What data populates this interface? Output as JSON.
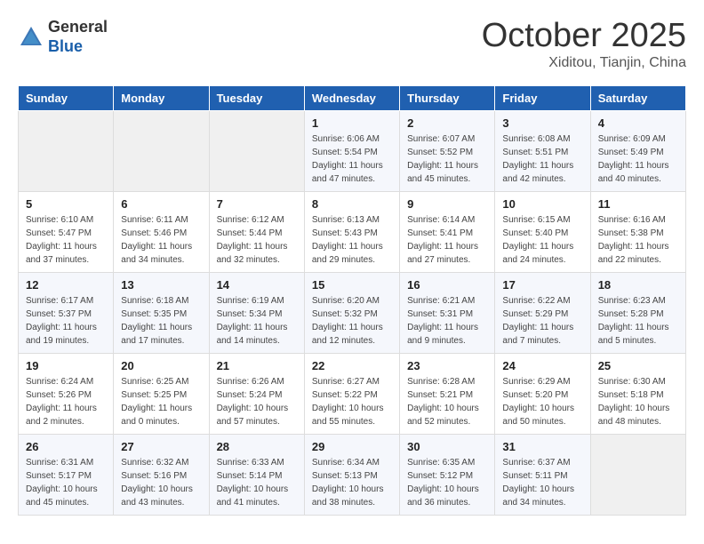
{
  "logo": {
    "general": "General",
    "blue": "Blue"
  },
  "header": {
    "title": "October 2025",
    "subtitle": "Xiditou, Tianjin, China"
  },
  "weekdays": [
    "Sunday",
    "Monday",
    "Tuesday",
    "Wednesday",
    "Thursday",
    "Friday",
    "Saturday"
  ],
  "weeks": [
    [
      {
        "day": "",
        "info": ""
      },
      {
        "day": "",
        "info": ""
      },
      {
        "day": "",
        "info": ""
      },
      {
        "day": "1",
        "info": "Sunrise: 6:06 AM\nSunset: 5:54 PM\nDaylight: 11 hours\nand 47 minutes."
      },
      {
        "day": "2",
        "info": "Sunrise: 6:07 AM\nSunset: 5:52 PM\nDaylight: 11 hours\nand 45 minutes."
      },
      {
        "day": "3",
        "info": "Sunrise: 6:08 AM\nSunset: 5:51 PM\nDaylight: 11 hours\nand 42 minutes."
      },
      {
        "day": "4",
        "info": "Sunrise: 6:09 AM\nSunset: 5:49 PM\nDaylight: 11 hours\nand 40 minutes."
      }
    ],
    [
      {
        "day": "5",
        "info": "Sunrise: 6:10 AM\nSunset: 5:47 PM\nDaylight: 11 hours\nand 37 minutes."
      },
      {
        "day": "6",
        "info": "Sunrise: 6:11 AM\nSunset: 5:46 PM\nDaylight: 11 hours\nand 34 minutes."
      },
      {
        "day": "7",
        "info": "Sunrise: 6:12 AM\nSunset: 5:44 PM\nDaylight: 11 hours\nand 32 minutes."
      },
      {
        "day": "8",
        "info": "Sunrise: 6:13 AM\nSunset: 5:43 PM\nDaylight: 11 hours\nand 29 minutes."
      },
      {
        "day": "9",
        "info": "Sunrise: 6:14 AM\nSunset: 5:41 PM\nDaylight: 11 hours\nand 27 minutes."
      },
      {
        "day": "10",
        "info": "Sunrise: 6:15 AM\nSunset: 5:40 PM\nDaylight: 11 hours\nand 24 minutes."
      },
      {
        "day": "11",
        "info": "Sunrise: 6:16 AM\nSunset: 5:38 PM\nDaylight: 11 hours\nand 22 minutes."
      }
    ],
    [
      {
        "day": "12",
        "info": "Sunrise: 6:17 AM\nSunset: 5:37 PM\nDaylight: 11 hours\nand 19 minutes."
      },
      {
        "day": "13",
        "info": "Sunrise: 6:18 AM\nSunset: 5:35 PM\nDaylight: 11 hours\nand 17 minutes."
      },
      {
        "day": "14",
        "info": "Sunrise: 6:19 AM\nSunset: 5:34 PM\nDaylight: 11 hours\nand 14 minutes."
      },
      {
        "day": "15",
        "info": "Sunrise: 6:20 AM\nSunset: 5:32 PM\nDaylight: 11 hours\nand 12 minutes."
      },
      {
        "day": "16",
        "info": "Sunrise: 6:21 AM\nSunset: 5:31 PM\nDaylight: 11 hours\nand 9 minutes."
      },
      {
        "day": "17",
        "info": "Sunrise: 6:22 AM\nSunset: 5:29 PM\nDaylight: 11 hours\nand 7 minutes."
      },
      {
        "day": "18",
        "info": "Sunrise: 6:23 AM\nSunset: 5:28 PM\nDaylight: 11 hours\nand 5 minutes."
      }
    ],
    [
      {
        "day": "19",
        "info": "Sunrise: 6:24 AM\nSunset: 5:26 PM\nDaylight: 11 hours\nand 2 minutes."
      },
      {
        "day": "20",
        "info": "Sunrise: 6:25 AM\nSunset: 5:25 PM\nDaylight: 11 hours\nand 0 minutes."
      },
      {
        "day": "21",
        "info": "Sunrise: 6:26 AM\nSunset: 5:24 PM\nDaylight: 10 hours\nand 57 minutes."
      },
      {
        "day": "22",
        "info": "Sunrise: 6:27 AM\nSunset: 5:22 PM\nDaylight: 10 hours\nand 55 minutes."
      },
      {
        "day": "23",
        "info": "Sunrise: 6:28 AM\nSunset: 5:21 PM\nDaylight: 10 hours\nand 52 minutes."
      },
      {
        "day": "24",
        "info": "Sunrise: 6:29 AM\nSunset: 5:20 PM\nDaylight: 10 hours\nand 50 minutes."
      },
      {
        "day": "25",
        "info": "Sunrise: 6:30 AM\nSunset: 5:18 PM\nDaylight: 10 hours\nand 48 minutes."
      }
    ],
    [
      {
        "day": "26",
        "info": "Sunrise: 6:31 AM\nSunset: 5:17 PM\nDaylight: 10 hours\nand 45 minutes."
      },
      {
        "day": "27",
        "info": "Sunrise: 6:32 AM\nSunset: 5:16 PM\nDaylight: 10 hours\nand 43 minutes."
      },
      {
        "day": "28",
        "info": "Sunrise: 6:33 AM\nSunset: 5:14 PM\nDaylight: 10 hours\nand 41 minutes."
      },
      {
        "day": "29",
        "info": "Sunrise: 6:34 AM\nSunset: 5:13 PM\nDaylight: 10 hours\nand 38 minutes."
      },
      {
        "day": "30",
        "info": "Sunrise: 6:35 AM\nSunset: 5:12 PM\nDaylight: 10 hours\nand 36 minutes."
      },
      {
        "day": "31",
        "info": "Sunrise: 6:37 AM\nSunset: 5:11 PM\nDaylight: 10 hours\nand 34 minutes."
      },
      {
        "day": "",
        "info": ""
      }
    ]
  ]
}
